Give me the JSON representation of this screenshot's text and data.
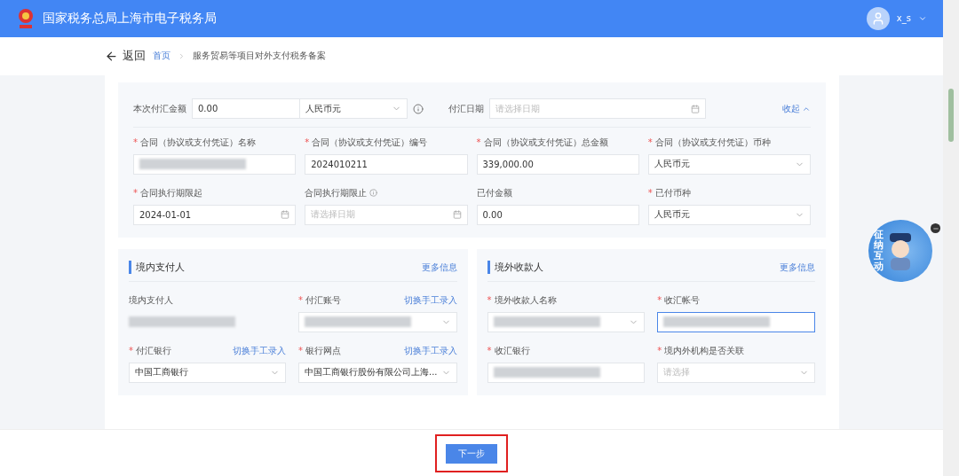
{
  "header": {
    "title": "国家税务总局上海市电子税务局",
    "user": "x_s"
  },
  "nav": {
    "back": "返回",
    "breadcrumb": [
      {
        "label": "首页",
        "link": true
      },
      {
        "label": "服务贸易等项目对外支付税务备案",
        "link": false
      }
    ]
  },
  "payment": {
    "amount_label": "本次付汇金额",
    "amount": "0.00",
    "currency": "人民币元",
    "date_label": "付汇日期",
    "date_placeholder": "请选择日期",
    "collapse": "收起"
  },
  "contract_fields": [
    {
      "label": "合同（协议或支付凭证）名称",
      "required": true,
      "kind": "text",
      "redacted": true
    },
    {
      "label": "合同（协议或支付凭证）编号",
      "required": true,
      "kind": "text",
      "value": "2024010211"
    },
    {
      "label": "合同（协议或支付凭证）总金额",
      "required": true,
      "kind": "text",
      "value": "339,000.00"
    },
    {
      "label": "合同（协议或支付凭证）币种",
      "required": true,
      "kind": "select",
      "value": "人民币元"
    },
    {
      "label": "合同执行期限起",
      "required": true,
      "kind": "date",
      "value": "2024-01-01"
    },
    {
      "label": "合同执行期限止",
      "required": false,
      "info": true,
      "kind": "date",
      "placeholder": "请选择日期"
    },
    {
      "label": "已付金额",
      "required": false,
      "kind": "text",
      "value": "0.00"
    },
    {
      "label": "已付币种",
      "required": true,
      "kind": "select",
      "value": "人民币元"
    }
  ],
  "payer": {
    "title": "境内支付人",
    "more": "更多信息",
    "fields": [
      {
        "label": "境内支付人",
        "required": false,
        "kind": "static",
        "redacted": true
      },
      {
        "label": "付汇账号",
        "required": true,
        "kind": "select",
        "redacted": true,
        "action": "切换手工录入"
      },
      {
        "label": "付汇银行",
        "required": true,
        "kind": "select",
        "value": "中国工商银行",
        "action": "切换手工录入"
      },
      {
        "label": "银行网点",
        "required": true,
        "kind": "select",
        "value": "中国工商银行股份有限公司上海...",
        "action": "切换手工录入"
      }
    ]
  },
  "payee": {
    "title": "境外收款人",
    "more": "更多信息",
    "fields": [
      {
        "label": "境外收款人名称",
        "required": true,
        "kind": "select",
        "redacted": true
      },
      {
        "label": "收汇帐号",
        "required": true,
        "kind": "text",
        "focused": true,
        "redacted": true
      },
      {
        "label": "收汇银行",
        "required": true,
        "kind": "text",
        "redacted": true
      },
      {
        "label": "境内外机构是否关联",
        "required": true,
        "kind": "select",
        "placeholder": "请选择"
      }
    ]
  },
  "required_marker": "*",
  "assistant": {
    "label": "征纳互动"
  },
  "next_button": {
    "label": "下一步",
    "highlighted": true
  }
}
